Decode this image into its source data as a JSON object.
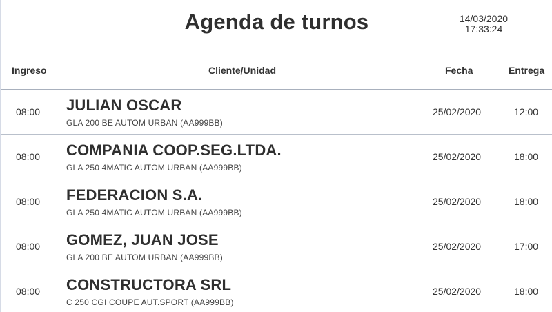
{
  "header": {
    "title": "Agenda de turnos",
    "date": "14/03/2020",
    "time": "17:33:24"
  },
  "columns": {
    "ingreso": "Ingreso",
    "cliente": "Cliente/Unidad",
    "fecha": "Fecha",
    "entrega": "Entrega"
  },
  "rows": [
    {
      "ingreso": "08:00",
      "cliente": "JULIAN OSCAR",
      "unidad": "GLA 200 BE AUTOM URBAN (AA999BB)",
      "fecha": "25/02/2020",
      "entrega": "12:00"
    },
    {
      "ingreso": "08:00",
      "cliente": "COMPANIA COOP.SEG.LTDA.",
      "unidad": "GLA 250 4MATIC AUTOM URBAN (AA999BB)",
      "fecha": "25/02/2020",
      "entrega": "18:00"
    },
    {
      "ingreso": "08:00",
      "cliente": "FEDERACION S.A.",
      "unidad": "GLA 250 4MATIC AUTOM URBAN (AA999BB)",
      "fecha": "25/02/2020",
      "entrega": "18:00"
    },
    {
      "ingreso": "08:00",
      "cliente": "GOMEZ, JUAN JOSE",
      "unidad": "GLA 200 BE AUTOM URBAN (AA999BB)",
      "fecha": "25/02/2020",
      "entrega": "17:00"
    },
    {
      "ingreso": "08:00",
      "cliente": "CONSTRUCTORA SRL",
      "unidad": "C 250 CGI COUPE AUT.SPORT (AA999BB)",
      "fecha": "25/02/2020",
      "entrega": "18:00"
    }
  ]
}
